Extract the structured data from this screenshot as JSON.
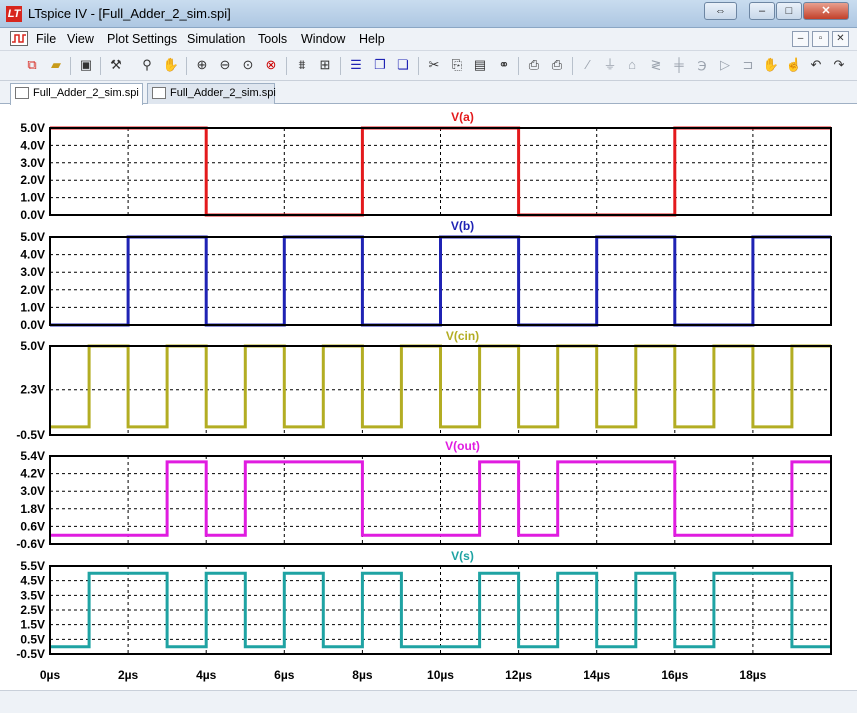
{
  "window": {
    "title": "LTspice IV - [Full_Adder_2_sim.spi]"
  },
  "menu": {
    "items": [
      "File",
      "View",
      "Plot Settings",
      "Simulation",
      "Tools",
      "Window",
      "Help"
    ]
  },
  "tabs": [
    {
      "label": "Full_Adder_2_sim.spi",
      "active": true
    },
    {
      "label": "Full_Adder_2_sim.spi",
      "active": false
    }
  ],
  "toolbar": {
    "icons": [
      "new-schematic-icon",
      "open-icon",
      "save-icon",
      "control-panel-icon",
      "run-icon",
      "halt-icon",
      "zoom-in-icon",
      "zoom-out-icon",
      "zoom-fit-icon",
      "zoom-cancel-icon",
      "autorange-icon",
      "grid-icon",
      "tile-horizontal-icon",
      "cascade-icon",
      "tile-vertical-icon",
      "cut-icon",
      "copy-icon",
      "paste-icon",
      "find-icon",
      "print-setup-icon",
      "print-icon",
      "wire-icon",
      "ground-icon",
      "label-icon",
      "resistor-icon",
      "capacitor-icon",
      "inductor-icon",
      "diode-icon",
      "component-icon",
      "move-icon",
      "drag-icon",
      "undo-icon",
      "redo-icon"
    ]
  },
  "chart_data": {
    "type": "line",
    "xlabel": "",
    "x_ticks": [
      "0µs",
      "2µs",
      "4µs",
      "6µs",
      "8µs",
      "10µs",
      "12µs",
      "14µs",
      "16µs",
      "18µs"
    ],
    "xlim": [
      0,
      20
    ],
    "grid": true,
    "panes": [
      {
        "name": "V(a)",
        "color": "#e31a1c",
        "ylim": [
          0,
          5
        ],
        "y_ticks": [
          "5.0V",
          "4.0V",
          "3.0V",
          "2.0V",
          "1.0V",
          "0.0V"
        ],
        "y_tick_values": [
          5,
          4,
          3,
          2,
          1,
          0
        ],
        "x": [
          0,
          4,
          4,
          8,
          8,
          12,
          12,
          16,
          16,
          20
        ],
        "y": [
          5,
          5,
          0,
          0,
          5,
          5,
          0,
          0,
          5,
          5
        ]
      },
      {
        "name": "V(b)",
        "color": "#1f23b4",
        "ylim": [
          0,
          5
        ],
        "y_ticks": [
          "5.0V",
          "4.0V",
          "3.0V",
          "2.0V",
          "1.0V",
          "0.0V"
        ],
        "y_tick_values": [
          5,
          4,
          3,
          2,
          1,
          0
        ],
        "x": [
          0,
          0,
          2,
          2,
          4,
          4,
          6,
          6,
          8,
          8,
          10,
          10,
          12,
          12,
          14,
          14,
          16,
          16,
          18,
          18,
          20
        ],
        "y": [
          0,
          0,
          0,
          5,
          5,
          0,
          0,
          5,
          5,
          0,
          0,
          5,
          5,
          0,
          0,
          5,
          5,
          0,
          0,
          5,
          5
        ]
      },
      {
        "name": "V(cin)",
        "color": "#b3ad23",
        "ylim": [
          -0.5,
          5
        ],
        "y_ticks": [
          "5.0V",
          "2.3V",
          "-0.5V"
        ],
        "y_tick_values": [
          5,
          2.3,
          -0.5
        ],
        "x": [
          0,
          1,
          1,
          2,
          2,
          3,
          3,
          4,
          4,
          5,
          5,
          6,
          6,
          7,
          7,
          8,
          8,
          9,
          9,
          10,
          10,
          11,
          11,
          12,
          12,
          13,
          13,
          14,
          14,
          15,
          15,
          16,
          16,
          17,
          17,
          18,
          18,
          19,
          19,
          20
        ],
        "y": [
          0,
          0,
          5,
          5,
          0,
          0,
          5,
          5,
          0,
          0,
          5,
          5,
          0,
          0,
          5,
          5,
          0,
          0,
          5,
          5,
          0,
          0,
          5,
          5,
          0,
          0,
          5,
          5,
          0,
          0,
          5,
          5,
          0,
          0,
          5,
          5,
          0,
          0,
          5,
          5
        ]
      },
      {
        "name": "V(out)",
        "color": "#e01ce0",
        "ylim": [
          -0.6,
          5.4
        ],
        "y_ticks": [
          "5.4V",
          "4.2V",
          "3.0V",
          "1.8V",
          "0.6V",
          "-0.6V"
        ],
        "y_tick_values": [
          5.4,
          4.2,
          3.0,
          1.8,
          0.6,
          -0.6
        ],
        "x": [
          0,
          3,
          3,
          4,
          4,
          5,
          5,
          6,
          6,
          8,
          8,
          11,
          11,
          12,
          12,
          13,
          13,
          14,
          14,
          16,
          16,
          19,
          19,
          20
        ],
        "y": [
          0,
          0,
          5,
          5,
          0,
          0,
          5,
          5,
          5,
          5,
          0,
          0,
          5,
          5,
          0,
          0,
          5,
          5,
          5,
          5,
          0,
          0,
          5,
          5
        ]
      },
      {
        "name": "V(s)",
        "color": "#1fa3a3",
        "ylim": [
          -0.5,
          5.5
        ],
        "y_ticks": [
          "5.5V",
          "4.5V",
          "3.5V",
          "2.5V",
          "1.5V",
          "0.5V",
          "-0.5V"
        ],
        "y_tick_values": [
          5.5,
          4.5,
          3.5,
          2.5,
          1.5,
          0.5,
          -0.5
        ],
        "x": [
          0,
          1,
          1,
          3,
          3,
          4,
          4,
          5,
          5,
          6,
          6,
          7,
          7,
          8,
          8,
          9,
          9,
          11,
          11,
          12,
          12,
          13,
          13,
          14,
          14,
          15,
          15,
          16,
          16,
          17,
          17,
          19,
          19,
          20
        ],
        "y": [
          0,
          0,
          5,
          5,
          0,
          0,
          5,
          5,
          0,
          0,
          5,
          5,
          0,
          0,
          5,
          5,
          0,
          0,
          5,
          5,
          0,
          0,
          5,
          5,
          0,
          0,
          5,
          5,
          0,
          0,
          5,
          5,
          0,
          0
        ]
      }
    ]
  }
}
